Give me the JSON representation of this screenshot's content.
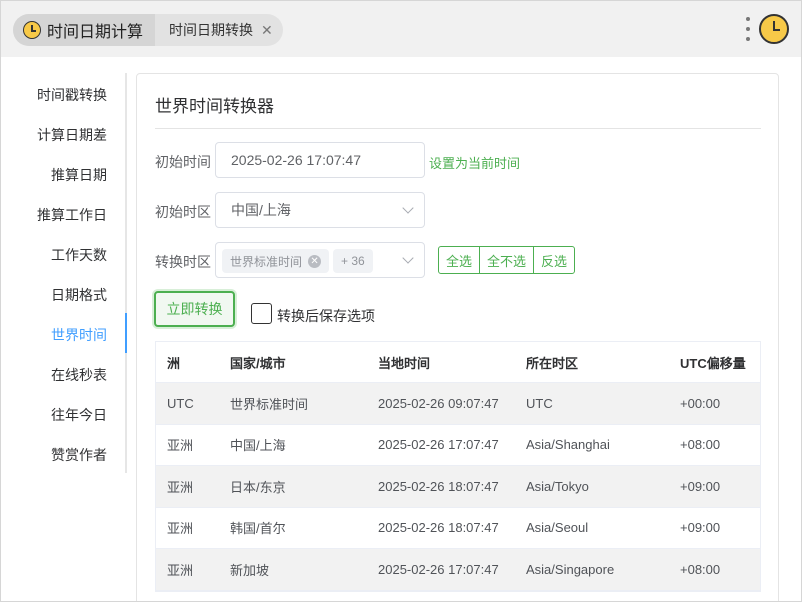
{
  "header": {
    "app_title": "时间日期计算",
    "tab_label": "时间日期转换"
  },
  "sidebar": {
    "items": [
      {
        "label": "时间戳转换"
      },
      {
        "label": "计算日期差"
      },
      {
        "label": "推算日期"
      },
      {
        "label": "推算工作日"
      },
      {
        "label": "工作天数"
      },
      {
        "label": "日期格式"
      },
      {
        "label": "世界时间"
      },
      {
        "label": "在线秒表"
      },
      {
        "label": "往年今日"
      },
      {
        "label": "赞赏作者"
      }
    ],
    "active_index": 6
  },
  "card": {
    "title": "世界时间转换器",
    "start_time_label": "初始时间",
    "start_time_value": "2025-02-26 17:07:47",
    "set_now_link": "设置为当前时间",
    "start_zone_label": "初始时区",
    "start_zone_value": "中国/上海",
    "target_zone_label": "转换时区",
    "target_zone_tag": "世界标准时间",
    "target_zone_more": "+ 36",
    "select_all": "全选",
    "select_none": "全不选",
    "select_invert": "反选",
    "convert_button": "立即转换",
    "save_option_label": "转换后保存选项"
  },
  "table": {
    "headers": [
      "洲",
      "国家/城市",
      "当地时间",
      "所在时区",
      "UTC偏移量"
    ],
    "rows": [
      [
        "UTC",
        "世界标准时间",
        "2025-02-26 09:07:47",
        "UTC",
        "+00:00"
      ],
      [
        "亚洲",
        "中国/上海",
        "2025-02-26 17:07:47",
        "Asia/Shanghai",
        "+08:00"
      ],
      [
        "亚洲",
        "日本/东京",
        "2025-02-26 18:07:47",
        "Asia/Tokyo",
        "+09:00"
      ],
      [
        "亚洲",
        "韩国/首尔",
        "2025-02-26 18:07:47",
        "Asia/Seoul",
        "+09:00"
      ],
      [
        "亚洲",
        "新加坡",
        "2025-02-26 17:07:47",
        "Asia/Singapore",
        "+08:00"
      ]
    ]
  },
  "colors": {
    "accent_green": "#4caf50",
    "active_blue": "#409eff",
    "clock_yellow": "#f7c948"
  },
  "icons": {
    "tab_icon": "clock-icon",
    "tab_close": "close-icon",
    "menu": "more-vertical-icon",
    "app_logo": "clock-icon",
    "select_arrow": "chevron-down-icon",
    "tag_remove": "circle-x-icon"
  }
}
